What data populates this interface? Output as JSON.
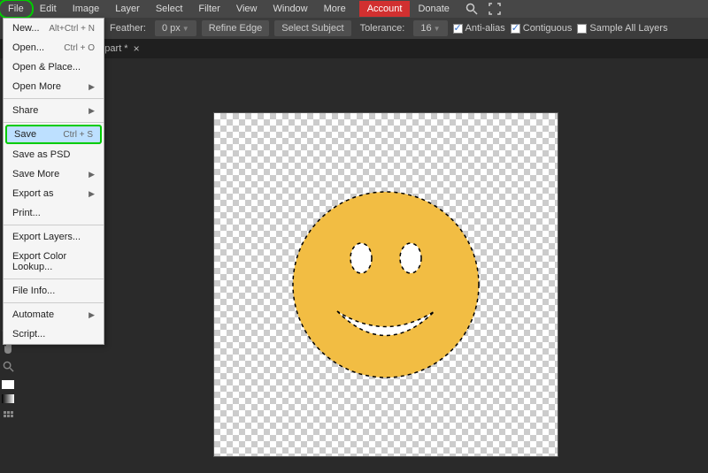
{
  "menubar": {
    "items": [
      "File",
      "Edit",
      "Image",
      "Layer",
      "Select",
      "Filter",
      "View",
      "Window",
      "More"
    ],
    "account": "Account",
    "donate": "Donate"
  },
  "options": {
    "feather_label": "Feather:",
    "feather_value": "0 px",
    "refine_edge": "Refine Edge",
    "select_subject": "Select Subject",
    "tolerance_label": "Tolerance:",
    "tolerance_value": "16",
    "anti_alias": "Anti-alias",
    "contiguous": "Contiguous",
    "sample_all": "Sample All Layers"
  },
  "tab": {
    "name": "free-smiley-face-clipart *"
  },
  "file_menu": {
    "new": "New...",
    "new_shortcut": "Alt+Ctrl + N",
    "open": "Open...",
    "open_shortcut": "Ctrl + O",
    "open_place": "Open & Place...",
    "open_more": "Open More",
    "share": "Share",
    "save": "Save",
    "save_shortcut": "Ctrl + S",
    "save_psd": "Save as PSD",
    "save_more": "Save More",
    "export_as": "Export as",
    "print": "Print...",
    "export_layers": "Export Layers...",
    "export_color": "Export Color Lookup...",
    "file_info": "File Info...",
    "automate": "Automate",
    "script": "Script..."
  }
}
